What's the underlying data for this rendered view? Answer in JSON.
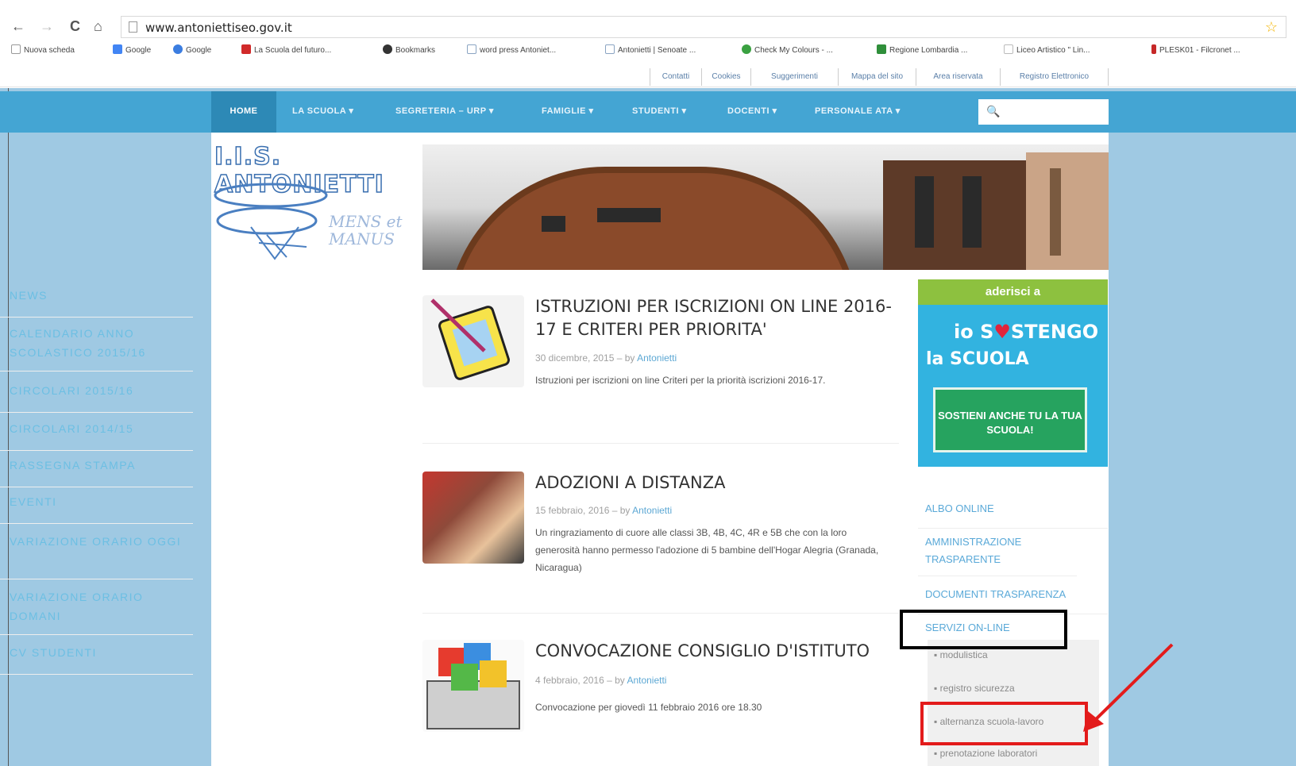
{
  "browser": {
    "nav": {
      "back": "←",
      "forward": "→",
      "reload": "C",
      "home": "⌂"
    },
    "url": "www.antoniettiseo.gov.it",
    "star": "☆",
    "bookmarks": [
      {
        "label": "Nuova scheda",
        "color": "#ffffff"
      },
      {
        "label": "Google",
        "color": "#4285f4"
      },
      {
        "label": "Google",
        "color": "#3b7de0"
      },
      {
        "label": "La Scuola del futuro...",
        "color": "#d12a2a"
      },
      {
        "label": "Bookmarks",
        "color": "#333333"
      },
      {
        "label": "word press Antoniet...",
        "color": "#8aa4c2"
      },
      {
        "label": "Antonietti | Senoate ...",
        "color": "#8aa4c2"
      },
      {
        "label": "Check My Colours - ...",
        "color": "#3aa141"
      },
      {
        "label": "Regione Lombardia ...",
        "color": "#2f8f3a"
      },
      {
        "label": "Liceo Artistico \" Lin...",
        "color": "#dddddd"
      },
      {
        "label": "PLESK01 - Filcronet ...",
        "color": "#c62828"
      }
    ]
  },
  "utility_links": [
    "Contatti",
    "Cookies",
    "Suggerimenti",
    "Mappa del sito",
    "Area riservata",
    "Registro Elettronico"
  ],
  "menu": {
    "items": [
      "HOME",
      "LA SCUOLA ▾",
      "SEGRETERIA – URP ▾",
      "FAMIGLIE ▾",
      "STUDENTI ▾",
      "DOCENTI ▾",
      "PERSONALE ATA ▾"
    ],
    "search_icon": "🔍"
  },
  "logo": {
    "title": "I.I.S. ANTONIETTI",
    "motto_line1": "MENS et",
    "motto_line2": "MANUS"
  },
  "left_nav": [
    "NEWS",
    "CALENDARIO ANNO SCOLASTICO 2015/16",
    "CIRCOLARI 2015/16",
    "CIRCOLARI 2014/15",
    "RASSEGNA STAMPA",
    "EVENTI",
    "VARIAZIONE ORARIO OGGI",
    "VARIAZIONE ORARIO DOMANI",
    "CV STUDENTI"
  ],
  "articles": [
    {
      "title": "ISTRUZIONI PER ISCRIZIONI ON LINE 2016-17 E CRITERI PER PRIORITA'",
      "date": "30 dicembre, 2015 – by ",
      "author": "Antonietti",
      "excerpt": "Istruzioni per iscrizioni on line Criteri per la priorità iscrizioni 2016-17."
    },
    {
      "title": "ADOZIONI A DISTANZA",
      "date": "15 febbraio, 2016 – by ",
      "author": "Antonietti",
      "excerpt": "Un ringraziamento di cuore alle classi 3B, 4B, 4C, 4R e 5B che con la loro generosità hanno permesso l'adozione di 5 bambine dell'Hogar Alegria (Granada, Nicaragua)"
    },
    {
      "title": "CONVOCAZIONE CONSIGLIO D'ISTITUTO",
      "date": "4 febbraio, 2016 – by ",
      "author": "Antonietti",
      "excerpt": "Convocazione per giovedì 11 febbraio 2016 ore 18.30"
    }
  ],
  "sostengo": {
    "top": "aderisci a",
    "logo1_a": "io S",
    "logo1_heart": "♥",
    "logo1_b": "STENGO",
    "logo2": "la SCUOLA",
    "button": "SOSTIENI ANCHE TU LA TUA SCUOLA!"
  },
  "right_nav": [
    "ALBO ONLINE",
    "AMMINISTRAZIONE TRASPARENTE",
    "DOCUMENTI TRASPARENZA",
    "SERVIZI ON-LINE"
  ],
  "right_sub": [
    "modulistica",
    "registro sicurezza",
    "alternanza scuola-lavoro",
    "prenotazione laboratori"
  ],
  "colors": {
    "menu_bar": "#44a5d3",
    "site_bg": "#9fc9e3",
    "highlight_black": "#000000",
    "highlight_red": "#e31b1b"
  }
}
